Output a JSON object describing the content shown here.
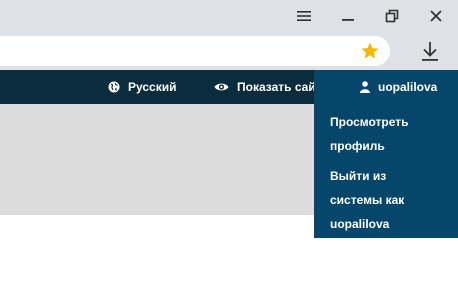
{
  "browser": {
    "window_buttons": [
      "menu-icon",
      "minimize-icon",
      "restore-icon",
      "close-icon"
    ],
    "bookmark_icon": "star-icon",
    "download_icon": "download-icon",
    "colors": {
      "chrome_bg": "#dee1e6",
      "star": "#f5b800"
    }
  },
  "navbar": {
    "language": {
      "icon": "globe-icon",
      "label": "Русский"
    },
    "view_site": {
      "icon": "eye-icon",
      "label": "Показать сайт"
    },
    "user": {
      "icon": "user-icon",
      "label": "uopalilova"
    },
    "colors": {
      "bg": "#0b2c3d",
      "active": "#06466a"
    }
  },
  "user_menu": {
    "items": [
      {
        "label_line1": "Просмотреть",
        "label_line2": "профиль"
      },
      {
        "label_line1": "Выйти из",
        "label_line2": "системы как",
        "label_line3": "uopalilova"
      }
    ]
  }
}
